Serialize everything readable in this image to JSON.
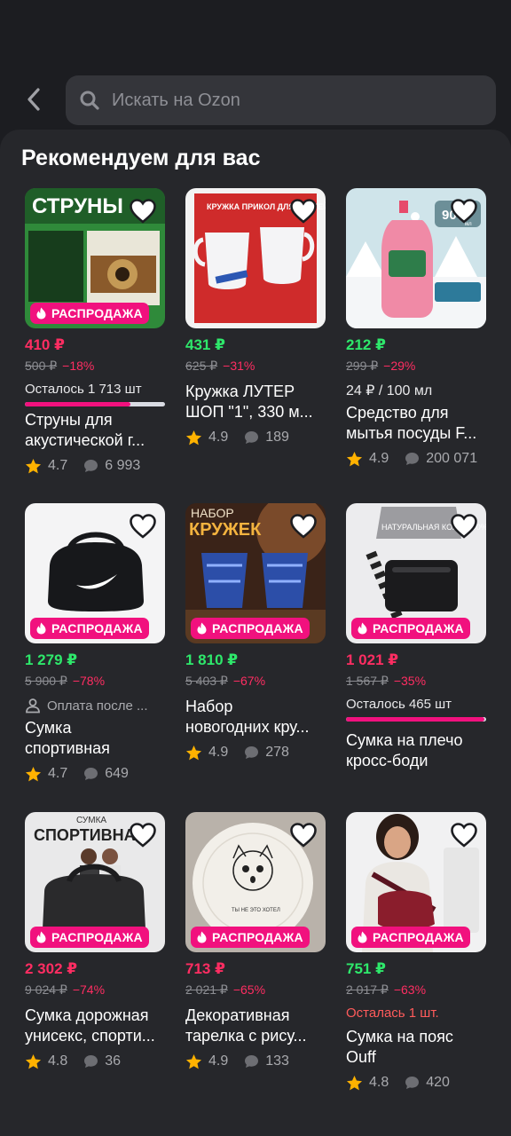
{
  "search": {
    "placeholder": "Искать на Ozon"
  },
  "section_title": "Рекомендуем для вас",
  "colors": {
    "accent_pink": "#f1117e",
    "price_red": "#ff2d62",
    "price_green": "#2ee86b",
    "star": "#ffb200"
  },
  "icons": {
    "back": "chevron-left-icon",
    "search": "search-icon",
    "favorite": "heart-outline-icon",
    "sale": "flame-icon",
    "rating": "star-icon",
    "reviews": "chat-bubble-icon",
    "payment_later": "user-icon"
  },
  "sale_badge_label": "РАСПРОДАЖА",
  "products": [
    {
      "thumb_text": "СТРУНЫ",
      "price": "410 ₽",
      "old_price": "500 ₽",
      "discount": "−18%",
      "extra": "Осталось 1 713 шт",
      "stock_fraction": 0.75,
      "name_lines": [
        "Струны для",
        "акустической г..."
      ],
      "rating": "4.7",
      "reviews": "6 993"
    },
    {
      "thumb_text": "КРУЖКА ПРИКОЛ ДЛЯ ГОСТЕЙ",
      "price": "431 ₽",
      "old_price": "625 ₽",
      "discount": "−31%",
      "extra": "",
      "name_lines": [
        "Кружка ЛУТЕР",
        "ШОП \"1\", 330 м..."
      ],
      "rating": "4.9",
      "reviews": "189"
    },
    {
      "thumb_text": "900",
      "thumb_text2": "мл",
      "price": "212 ₽",
      "old_price": "299 ₽",
      "discount": "−29%",
      "extra": "24 ₽ / 100 мл",
      "name_lines": [
        "Средство для",
        "мытья посуды F..."
      ],
      "rating": "4.9",
      "reviews": "200 071"
    },
    {
      "price": "1 279 ₽",
      "old_price": "5 900 ₽",
      "discount": "−78%",
      "extra": "Оплата после ...",
      "name_lines": [
        "Сумка",
        "спортивная"
      ],
      "rating": "4.7",
      "reviews": "649"
    },
    {
      "thumb_text": "НАБОР",
      "thumb_text2": "КРУЖЕК",
      "price": "1 810 ₽",
      "old_price": "5 403 ₽",
      "discount": "−67%",
      "extra": "",
      "name_lines": [
        "Набор",
        "новогодних кру..."
      ],
      "rating": "4.9",
      "reviews": "278"
    },
    {
      "thumb_text": "НАТУРАЛЬНАЯ КОЖА 100%",
      "price": "1 021 ₽",
      "old_price": "1 567 ₽",
      "discount": "−35%",
      "extra": "Осталось 465 шт",
      "stock_fraction": 0.99,
      "name_lines": [
        "Сумка на плечо",
        "кросс-боди"
      ],
      "rating": "",
      "reviews": ""
    },
    {
      "thumb_text": "СУМКА",
      "thumb_text2": "СПОРТИВНАЯ",
      "price": "2 302 ₽",
      "old_price": "9 024 ₽",
      "discount": "−74%",
      "extra": "",
      "name_lines": [
        "Сумка дорожная",
        "унисекс, спорти..."
      ],
      "rating": "4.8",
      "reviews": "36"
    },
    {
      "thumb_text": "ТЫ НЕ ЭТО ХОТЕЛ",
      "price": "713 ₽",
      "old_price": "2 021 ₽",
      "discount": "−65%",
      "extra": "",
      "name_lines": [
        "Декоративная",
        "тарелка с рису..."
      ],
      "rating": "4.9",
      "reviews": "133"
    },
    {
      "price": "751 ₽",
      "old_price": "2 017 ₽",
      "discount": "−63%",
      "extra": "Осталась 1 шт.",
      "name_lines": [
        "Сумка на пояс",
        "Ouff"
      ],
      "rating": "4.8",
      "reviews": "420"
    }
  ]
}
